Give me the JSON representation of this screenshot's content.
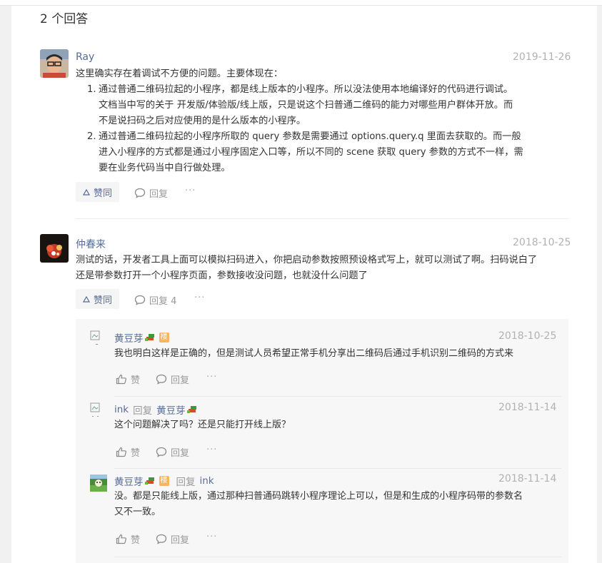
{
  "answers_heading": "2 个回答",
  "answer1": {
    "author": "Ray",
    "date": "2019-11-26",
    "intro": "这里确实存在着调试不方便的问题。主要体现在：",
    "items": [
      {
        "num": "1.",
        "lines": [
          "通过普通二维码拉起的小程序，都是线上版本的小程序。所以没法使用本地编译好的代码进行调试。",
          "文档当中写的关于 开发版/体验版/线上版，只是说这个扫普通二维码的能力对哪些用户群体开放。而",
          "不是说扫码之后对应使用的是什么版本的小程序。"
        ]
      },
      {
        "num": "2.",
        "lines": [
          "通过普通二维码拉起的小程序所取的 query 参数是需要通过 options.query.q 里面去获取的。而一般",
          "进入小程序的方式都是通过小程序固定入口等，所以不同的 scene 获取 query 参数的方式不一样，需",
          "要在业务代码当中自行做处理。"
        ]
      }
    ],
    "like_label": "赞同",
    "reply_label": "回复",
    "more_label": "···"
  },
  "answer2": {
    "author": "仲春来",
    "date": "2018-10-25",
    "lines": [
      "测试的话，开发者工具上面可以模拟扫码进入，你把启动参数按照预设格式写上，就可以测试了啊。扫码说白了",
      "还是带参数打开一个小程序页面，参数接收没问题，也就没什么问题了"
    ],
    "like_label": "赞同",
    "reply_label": "回复 4",
    "more_label": "···"
  },
  "replies": [
    {
      "author": "黄豆芽",
      "badge": "楼",
      "date": "2018-10-25",
      "lines": [
        "我也明白这样是正确的，但是测试人员希望正常手机分享出二维码后通过手机识别二维码的方式来"
      ],
      "like_label": "赞",
      "reply_label": "回复",
      "more_label": "···"
    },
    {
      "author": "ink",
      "reply_word": "回复",
      "reply_to": "黄豆芽",
      "date": "2018-11-14",
      "lines": [
        "这个问题解决了吗？还是只能打开线上版？"
      ],
      "like_label": "赞",
      "reply_label": "回复",
      "more_label": "···"
    },
    {
      "author": "黄豆芽",
      "badge": "楼",
      "reply_word": "回复",
      "reply_to": "ink",
      "date": "2018-11-14",
      "lines": [
        "没。都是只能线上版，通过那种扫普通码跳转小程序理论上可以，但是和生成的小程序码带的参数名",
        "又不一致。"
      ],
      "like_label": "赞",
      "reply_label": "回复",
      "more_label": "···"
    }
  ],
  "colors": {
    "link": "#576b95",
    "date": "#b2b2b2",
    "badge": "#f7b55f"
  }
}
